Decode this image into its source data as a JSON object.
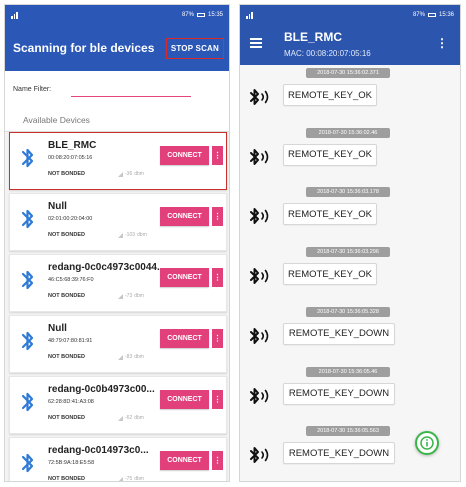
{
  "left": {
    "status": {
      "signal": "ᴴ⁴ᴿ",
      "right": "⫹ 87% ▭ 15:35",
      "battery": "87%",
      "time": "15:35"
    },
    "appbar": {
      "title": "Scanning for ble devices",
      "stop_scan_label": "STOP SCAN"
    },
    "filter": {
      "label": "Name Filter:",
      "value": ""
    },
    "section_label": "Available Devices",
    "devices": [
      {
        "name": "BLE_RMC",
        "mac": "00:08:20:07:05:16",
        "bond": "NOT BONDED",
        "rssi": "-36",
        "unit": "dbm",
        "connect": "CONNECT",
        "more": "⋮"
      },
      {
        "name": "Null",
        "mac": "02:01:00:20:04:00",
        "bond": "NOT BONDED",
        "rssi": "-103",
        "unit": "dbm",
        "connect": "CONNECT",
        "more": "⋮"
      },
      {
        "name": "redang-0c0c4973c0044...",
        "mac": "46:C5:68:39:76:F0",
        "bond": "NOT BONDED",
        "rssi": "-73",
        "unit": "dbm",
        "connect": "CONNECT",
        "more": "⋮"
      },
      {
        "name": "Null",
        "mac": "48:79:07:80:81:91",
        "bond": "NOT BONDED",
        "rssi": "-83",
        "unit": "dbm",
        "connect": "CONNECT",
        "more": "⋮"
      },
      {
        "name": "redang-0c0b4973c00...",
        "mac": "62:28:8D:41:A3:08",
        "bond": "NOT BONDED",
        "rssi": "-62",
        "unit": "dbm",
        "connect": "CONNECT",
        "more": "⋮"
      },
      {
        "name": "redang-0c014973c0...",
        "mac": "72:5B:9A:18:E5:58",
        "bond": "NOT BONDED",
        "rssi": "-75",
        "unit": "dbm",
        "connect": "CONNECT",
        "more": "⋮"
      }
    ]
  },
  "right": {
    "status": {
      "signal": "ᴴ⁴ᴿ",
      "right": "⫹ 87% ▭ 15:36",
      "battery": "87%",
      "time": "15:36"
    },
    "appbar": {
      "title": "BLE_RMC",
      "subtitle": "MAC: 00:08:20:07:05:16",
      "menu": "⋮"
    },
    "messages": [
      {
        "timestamp": "2018-07-30 15:36:02.371",
        "command": "REMOTE_KEY_OK"
      },
      {
        "timestamp": "2018-07-30 15:36:02.46",
        "command": "REMOTE_KEY_OK"
      },
      {
        "timestamp": "2018-07-30 15:36:03.178",
        "command": "REMOTE_KEY_OK"
      },
      {
        "timestamp": "2018-07-30 15:36:03.296",
        "command": "REMOTE_KEY_OK"
      },
      {
        "timestamp": "2018-07-30 15:36:05.328",
        "command": "REMOTE_KEY_DOWN"
      },
      {
        "timestamp": "2018-07-30 15:36:05.46",
        "command": "REMOTE_KEY_DOWN"
      },
      {
        "timestamp": "2018-07-30 15:36:05.563",
        "command": "REMOTE_KEY_DOWN"
      }
    ],
    "fab_icon": "info-icon"
  },
  "colors": {
    "appbar_blue": "#2b57b6",
    "accent_pink": "#e2407a",
    "selected_border": "#c9302c",
    "fab_green": "#3bb54a",
    "bt_blue": "#2f7ad6"
  }
}
